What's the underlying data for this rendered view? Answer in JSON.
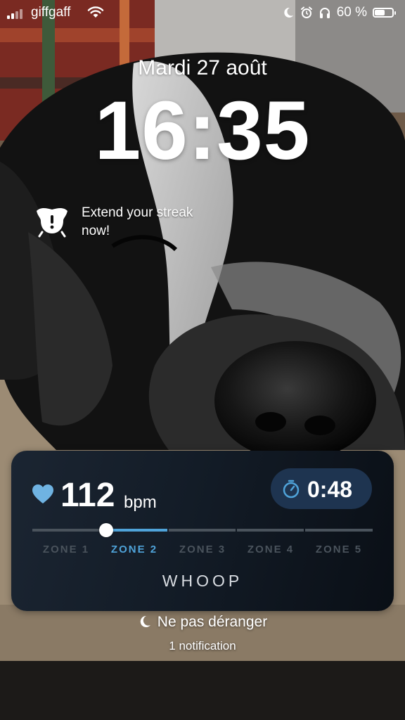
{
  "status_bar": {
    "carrier": "giffgaff",
    "battery_percent": "60 %",
    "battery_level": 0.6,
    "icons": [
      "signal-icon",
      "wifi-icon",
      "moon-icon",
      "alarm-icon",
      "headphones-icon",
      "battery-icon"
    ]
  },
  "lock_screen": {
    "date": "Mardi 27 août",
    "time": "16:35"
  },
  "streak_widget": {
    "icon": "streak-mascot-icon",
    "text": "Extend your streak now!"
  },
  "whoop_widget": {
    "heart_rate": "112",
    "unit": "bpm",
    "timer": "0:48",
    "current_zone_position": 0.21,
    "zones": [
      {
        "label": "ZONE 1",
        "active": false
      },
      {
        "label": "ZONE 2",
        "active": true
      },
      {
        "label": "ZONE 3",
        "active": false
      },
      {
        "label": "ZONE 4",
        "active": false
      },
      {
        "label": "ZONE 5",
        "active": false
      }
    ],
    "brand": "WHOOP",
    "colors": {
      "accent": "#4fa3d9",
      "inactive": "#4a535c",
      "pill": "#1e3450"
    }
  },
  "focus": {
    "label": "Ne pas déranger",
    "icon": "moon-icon",
    "notifications": "1 notification"
  }
}
